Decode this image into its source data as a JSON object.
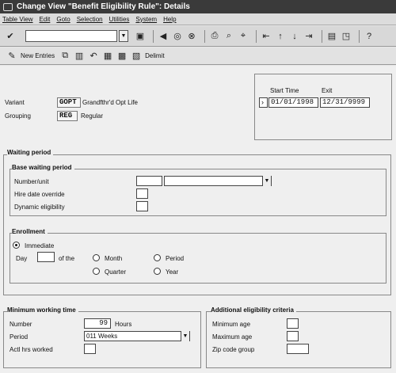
{
  "window": {
    "title": "Change View \"Benefit Eligibility Rule\": Details"
  },
  "menu": [
    "Table View",
    "Edit",
    "Goto",
    "Selection",
    "Utilities",
    "System",
    "Help"
  ],
  "toolbar2": {
    "new_entries": "New Entries",
    "delimit": "Delimit"
  },
  "header": {
    "variant_label": "Variant",
    "variant_value": "GOPT",
    "variant_text": "Grandfthr'd Opt Life",
    "grouping_label": "Grouping",
    "grouping_value": "REG",
    "grouping_text": "Regular",
    "start_time_label": "Start Time",
    "exit_label": "Exit",
    "start_date": "01/01/1998",
    "end_date": "12/31/9999"
  },
  "waiting_period": {
    "title": "Waiting period",
    "base": {
      "title": "Base waiting period",
      "number_unit_label": "Number/unit",
      "hire_date_label": "Hire date override",
      "dynamic_label": "Dynamic eligibility"
    },
    "enrollment": {
      "title": "Enrollment",
      "immediate_label": "Immediate",
      "day_label": "Day",
      "of_the_label": "of the",
      "month_label": "Month",
      "quarter_label": "Quarter",
      "period_label": "Period",
      "year_label": "Year"
    }
  },
  "min_working": {
    "title": "Minimum working time",
    "number_label": "Number",
    "number_value": "99",
    "hours_label": "Hours",
    "period_label": "Period",
    "period_value": "011 Weeks",
    "actl_label": "Actl hrs worked"
  },
  "additional": {
    "title": "Additional eligibility criteria",
    "min_age_label": "Minimum age",
    "max_age_label": "Maximum age",
    "zip_label": "Zip code group"
  }
}
